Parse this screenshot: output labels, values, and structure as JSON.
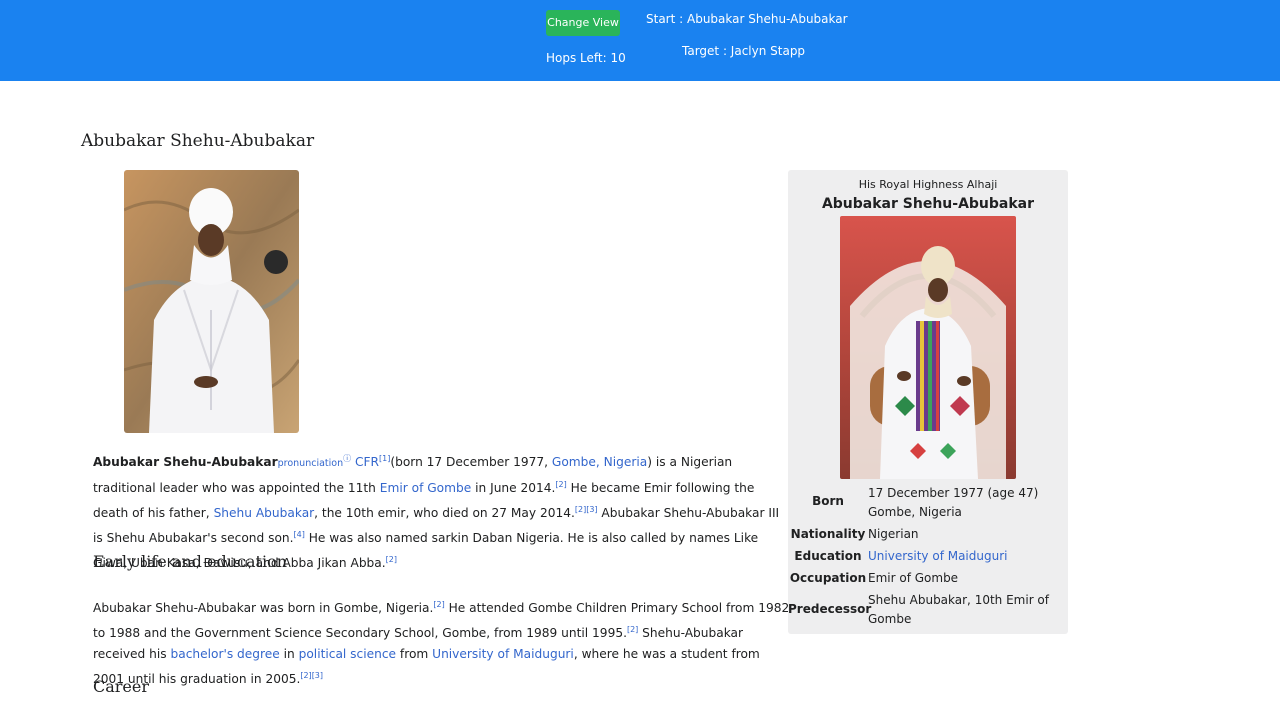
{
  "topbar": {
    "change_view_label": "Change View",
    "hops_left": "Hops Left: 10",
    "start": "Start : Abubakar Shehu-Abubakar",
    "target": "Target : Jaclyn Stapp"
  },
  "article": {
    "title": "Abubakar Shehu-Abubakar",
    "intro": {
      "bold_name": "Abubakar Shehu-Abubakar",
      "pronunciation": "pronunciation",
      "pron_sup": "ⓘ",
      "cfr": "CFR",
      "ref1": "[1]",
      "t1": "(born 17 December 1977, ",
      "gombe_nigeria": "Gombe, Nigeria",
      "t2": ") is a Nigerian traditional leader who was appointed the 11th ",
      "emir_of_gombe": "Emir of Gombe",
      "t3": " in June 2014.",
      "ref2": "[2]",
      "t4": " He became Emir following the death of his father, ",
      "shehu_abubakar": "Shehu Abubakar",
      "t5": ", the 10th emir, who died on 27 May 2014.",
      "ref2b": "[2]",
      "ref3": "[3]",
      "t6": " Abubakar Shehu-Abubakar III is Shehu Abubakar's second son.",
      "ref4": "[4]",
      "t7": " He was also named sarkin Daban Nigeria. He is also called by names Like Giwa, Uban Kasa, Ɖawisu, and Abba Jikan Abba.",
      "ref2c": "[2]"
    },
    "early_life": {
      "heading": "Early life and education",
      "t1": "Abubakar Shehu-Abubakar was born in Gombe, Nigeria.",
      "ref2": "[2]",
      "t2": " He attended Gombe Children Primary School from 1982 to 1988 and the Government Science Secondary School, Gombe, from 1989 until 1995.",
      "ref2b": "[2]",
      "t3": " Shehu-Abubakar received his ",
      "bachelors": "bachelor's degree",
      "t4": " in ",
      "polsci": "political science",
      "t5": " from ",
      "unimaid": "University of Maiduguri",
      "t6": ", where he was a student from 2001 until his graduation in 2005.",
      "ref2c": "[2]",
      "ref3": "[3]"
    },
    "career_heading": "Career"
  },
  "infobox": {
    "above": "His Royal Highness Alhaji",
    "name": "Abubakar Shehu-Abubakar",
    "rows": [
      {
        "label": "Born",
        "value": "17 December 1977 (age 47) Gombe, Nigeria"
      },
      {
        "label": "Nationality",
        "value": "Nigerian"
      },
      {
        "label": "Education",
        "value": "University of Maiduguri"
      },
      {
        "label": "Occupation",
        "value": "Emir of Gombe"
      },
      {
        "label": "Predecessor",
        "value": "Shehu Abubakar, 10th Emir of Gombe"
      }
    ]
  },
  "colors": {
    "topbar": "#1a82f0",
    "button": "#2ab45a",
    "link": "#3366cc",
    "infobox_bg": "#eeeeef"
  }
}
